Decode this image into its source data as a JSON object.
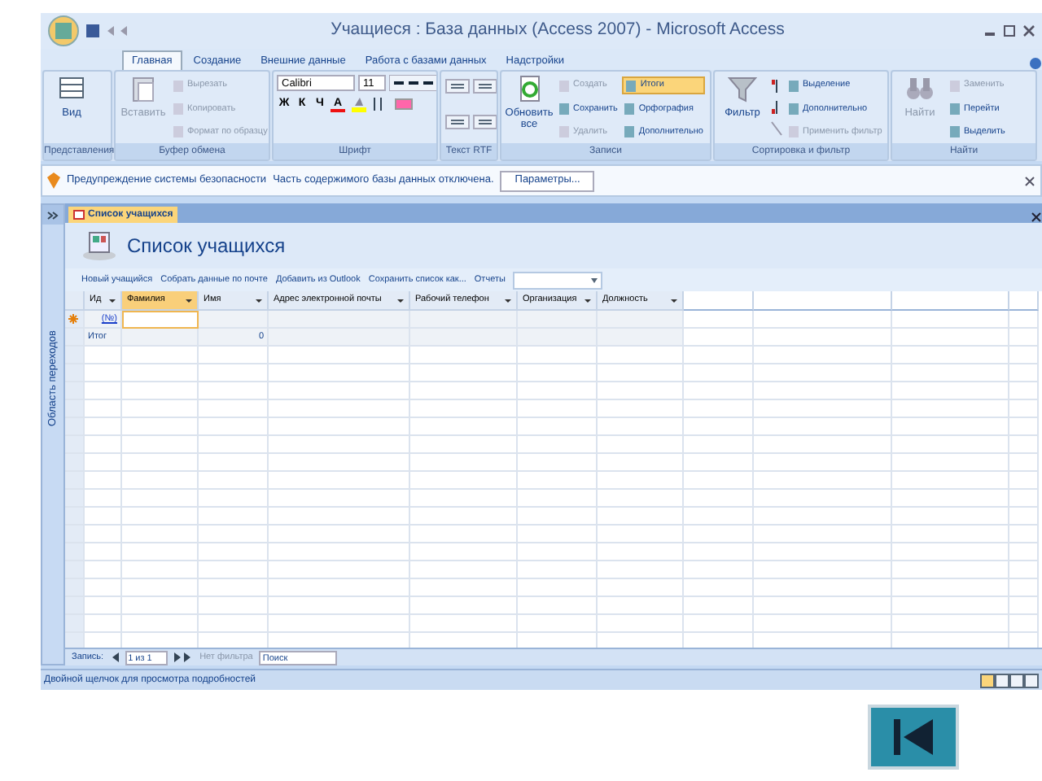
{
  "window": {
    "title": "Учащиеся : База данных (Access 2007) - Microsoft Access"
  },
  "ribbon": {
    "tabs": [
      {
        "label": "Главная",
        "selected": true
      },
      {
        "label": "Создание",
        "selected": false
      },
      {
        "label": "Внешние данные",
        "selected": false
      },
      {
        "label": "Работа с базами данных",
        "selected": false
      },
      {
        "label": "Надстройки",
        "selected": false
      }
    ],
    "groups": [
      {
        "label": "Представления",
        "large": [
          {
            "label": "Вид",
            "disabled": false
          }
        ]
      },
      {
        "label": "Буфер обмена",
        "large": [
          {
            "label": "Вставить",
            "disabled": true
          }
        ],
        "small": [
          {
            "label": "Вырезать",
            "disabled": true,
            "on": false
          },
          {
            "label": "Копировать",
            "disabled": true,
            "on": false
          },
          {
            "label": "Формат по образцу",
            "disabled": true,
            "on": false
          }
        ]
      },
      {
        "label": "Шрифт",
        "kind": "font",
        "font": "Calibri",
        "size": "11",
        "format_buttons": [
          "Ж",
          "К",
          "Ч",
          "A"
        ]
      },
      {
        "label": "Текст RTF",
        "kind": "rtf"
      },
      {
        "label": "Записи",
        "large": [
          {
            "label": "Обновить все",
            "disabled": false
          }
        ],
        "small": [
          {
            "label": "Создать",
            "disabled": true,
            "on": false
          },
          {
            "label": "Сохранить",
            "disabled": false,
            "on": false
          },
          {
            "label": "Удалить",
            "disabled": true,
            "on": false
          },
          {
            "label": "Итоги",
            "disabled": false,
            "on": true
          },
          {
            "label": "Орфография",
            "disabled": false,
            "on": false
          },
          {
            "label": "Дополнительно",
            "disabled": false,
            "on": false
          }
        ]
      },
      {
        "label": "Сортировка и фильтр",
        "large": [
          {
            "label": "Фильтр",
            "disabled": false
          }
        ],
        "small": [
          {
            "label": "Выделение",
            "disabled": false,
            "on": false
          },
          {
            "label": "Дополнительно",
            "disabled": false,
            "on": false
          },
          {
            "label": "Применить фильтр",
            "disabled": true,
            "on": false
          }
        ]
      },
      {
        "label": "Найти",
        "large": [
          {
            "label": "Найти",
            "disabled": true
          }
        ],
        "small": [
          {
            "label": "Заменить",
            "disabled": true,
            "on": false
          },
          {
            "label": "Перейти",
            "disabled": false,
            "on": false
          },
          {
            "label": "Выделить",
            "disabled": false,
            "on": false
          }
        ]
      }
    ]
  },
  "message_bar": {
    "title": "Предупреждение системы безопасности",
    "text": "Часть содержимого базы данных отключена.",
    "button": "Параметры..."
  },
  "navigation_pane": {
    "label": "Область переходов"
  },
  "document_tab": {
    "label": "Список учащихся"
  },
  "form": {
    "title": "Список учащихся",
    "links": [
      "Новый учащийся",
      "Собрать данные по почте",
      "Добавить из Outlook",
      "Сохранить список как...",
      "Отчеты"
    ]
  },
  "table": {
    "columns": [
      "Ид",
      "Фамилия",
      "Имя",
      "Адрес электронной почты",
      "Рабочий телефон",
      "Организация",
      "Должность"
    ],
    "new_row": {
      "id": "(№)"
    },
    "total_row": {
      "label": "Итог",
      "name_count": "0"
    }
  },
  "record_nav": {
    "label": "Запись:",
    "position": "1 из 1",
    "filter": "Нет фильтра",
    "search": "Поиск"
  },
  "status_bar": {
    "text": "Двойной щелчок для просмотра подробностей"
  }
}
